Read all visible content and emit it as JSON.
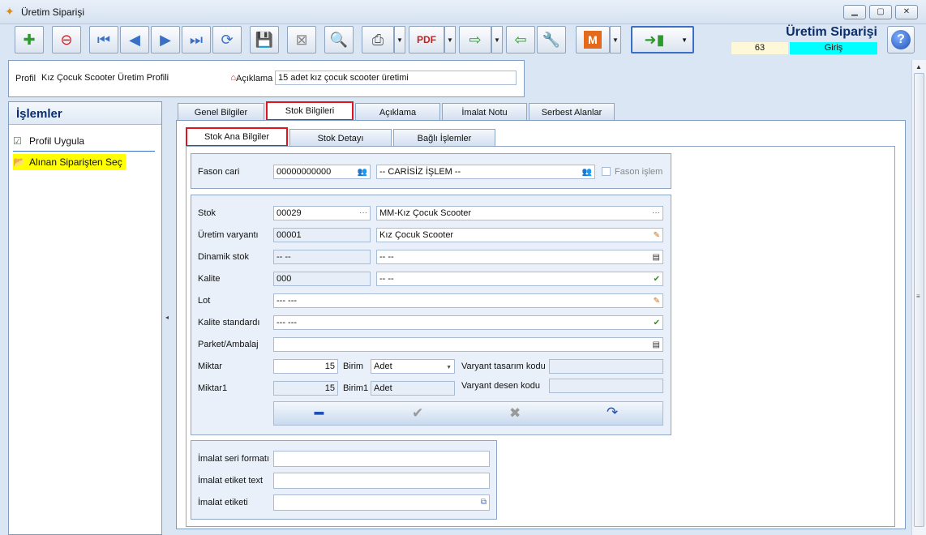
{
  "window": {
    "title": "Üretim Siparişi"
  },
  "header": {
    "app_title": "Üretim Siparişi",
    "record_no": "63",
    "mode": "Giriş"
  },
  "profile": {
    "profil_label": "Profil",
    "profil_value": "Kız Çocuk Scooter Üretim Profili",
    "aciklama_label": "Açıklama",
    "aciklama_value": "15 adet kız çocuk scooter üretimi"
  },
  "sidebar": {
    "title": "İşlemler",
    "items": [
      {
        "label": "Profil Uygula"
      },
      {
        "label": "Alınan Siparişten Seç"
      }
    ]
  },
  "tabs": [
    {
      "label": "Genel Bilgiler"
    },
    {
      "label": "Stok Bilgileri"
    },
    {
      "label": "Açıklama"
    },
    {
      "label": "İmalat Notu"
    },
    {
      "label": "Serbest Alanlar"
    }
  ],
  "subtabs": [
    {
      "label": "Stok Ana Bilgiler"
    },
    {
      "label": "Stok Detayı"
    },
    {
      "label": "Bağlı İşlemler"
    }
  ],
  "fason": {
    "cari_label": "Fason cari",
    "cari_code": "00000000000",
    "cari_name": "-- CARİSİZ İŞLEM --",
    "islem_label": "Fason işlem"
  },
  "stock": {
    "stok_label": "Stok",
    "stok_code": "00029",
    "stok_name": "MM-Kız Çocuk Scooter",
    "varyant_label": "Üretim varyantı",
    "varyant_code": "00001",
    "varyant_name": "Kız Çocuk Scooter",
    "dinamik_label": "Dinamik stok",
    "dinamik_code": "-- --",
    "dinamik_name": "-- --",
    "kalite_label": "Kalite",
    "kalite_code": "000",
    "kalite_name": "-- --",
    "lot_label": "Lot",
    "lot_value": "--- ---",
    "kstd_label": "Kalite standardı",
    "kstd_value": "--- ---",
    "parket_label": "Parket/Ambalaj",
    "parket_value": "",
    "miktar_label": "Miktar",
    "miktar_value": "15",
    "birim_label": "Birim",
    "birim_value": "Adet",
    "miktar1_label": "Miktar1",
    "miktar1_value": "15",
    "birim1_label": "Birim1",
    "birim1_value": "Adet",
    "vtasarim_label": "Varyant tasarım kodu",
    "vtasarim_value": "",
    "vdesen_label": "Varyant desen kodu",
    "vdesen_value": ""
  },
  "imalat": {
    "seri_label": "İmalat seri formatı",
    "seri_value": "",
    "etiket_text_label": "İmalat etiket text",
    "etiket_text_value": "",
    "etiket_label": "İmalat etiketi",
    "etiket_value": ""
  },
  "colors": {
    "accent": "#e0141c",
    "mode_bg": "#00ffff",
    "highlight": "#ffff00",
    "title": "#0c2f6b"
  }
}
